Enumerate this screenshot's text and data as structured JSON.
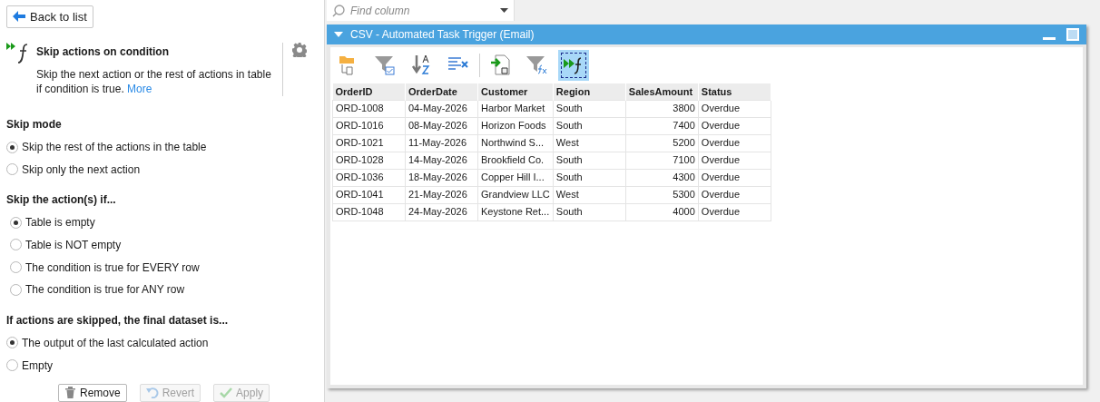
{
  "back_button": {
    "label": "Back to list"
  },
  "action": {
    "title": "Skip actions on condition",
    "description": "Skip the next action or the rest of actions in table if condition is true.",
    "more_link": "More"
  },
  "sections": [
    {
      "heading": "Skip mode",
      "options": [
        {
          "label": "Skip the rest of the actions in the table",
          "selected": true
        },
        {
          "label": "Skip only the next action",
          "selected": false
        }
      ]
    },
    {
      "heading": "Skip the action(s) if...",
      "options": [
        {
          "label": "Table is empty",
          "selected": true
        },
        {
          "label": "Table is NOT empty",
          "selected": false
        },
        {
          "label": "The condition is true for EVERY row",
          "selected": false
        },
        {
          "label": "The condition is true for ANY row",
          "selected": false
        }
      ]
    },
    {
      "heading": "If actions are skipped, the final dataset is...",
      "options": [
        {
          "label": "The output of the last calculated action",
          "selected": true
        },
        {
          "label": "Empty",
          "selected": false
        }
      ]
    }
  ],
  "footer_buttons": [
    {
      "kind": "remove",
      "label": "Remove",
      "disabled": false
    },
    {
      "kind": "revert",
      "label": "Revert",
      "disabled": true
    },
    {
      "kind": "apply",
      "label": "Apply",
      "disabled": true
    }
  ],
  "search": {
    "placeholder": "Find column"
  },
  "panel": {
    "title": "CSV - Automated Task Trigger (Email)"
  },
  "toolbar": [
    {
      "kind": "folder",
      "selected": false
    },
    {
      "kind": "filter-check",
      "selected": false
    },
    {
      "kind": "sort",
      "selected": false
    },
    {
      "kind": "split",
      "selected": false
    },
    {
      "kind": "import",
      "selected": false
    },
    {
      "kind": "filter-fx",
      "selected": false
    },
    {
      "kind": "skip",
      "selected": true
    }
  ],
  "table": {
    "columns": [
      "OrderID",
      "OrderDate",
      "Customer",
      "Region",
      "SalesAmount",
      "Status"
    ],
    "rows": [
      [
        "ORD-1008",
        "04-May-2026",
        "Harbor Market",
        "South",
        "3800",
        "Overdue"
      ],
      [
        "ORD-1016",
        "08-May-2026",
        "Horizon Foods",
        "South",
        "7400",
        "Overdue"
      ],
      [
        "ORD-1021",
        "11-May-2026",
        "Northwind S...",
        "West",
        "5200",
        "Overdue"
      ],
      [
        "ORD-1028",
        "14-May-2026",
        "Brookfield Co.",
        "South",
        "7100",
        "Overdue"
      ],
      [
        "ORD-1036",
        "18-May-2026",
        "Copper Hill I...",
        "South",
        "4300",
        "Overdue"
      ],
      [
        "ORD-1041",
        "21-May-2026",
        "Grandview LLC",
        "West",
        "5300",
        "Overdue"
      ],
      [
        "ORD-1048",
        "24-May-2026",
        "Keystone Ret...",
        "South",
        "4000",
        "Overdue"
      ]
    ]
  }
}
